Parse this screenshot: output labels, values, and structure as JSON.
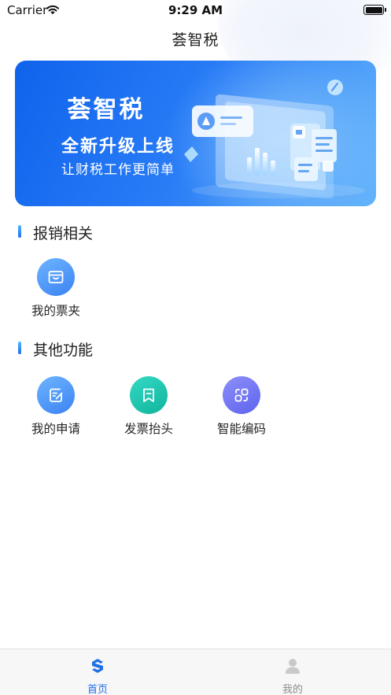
{
  "status_bar": {
    "carrier": "Carrier",
    "time": "9:29 AM"
  },
  "nav": {
    "title": "荟智税"
  },
  "banner": {
    "title": "荟智税",
    "subtitle": "全新升级上线",
    "tagline": "让财税工作更简单"
  },
  "sections": [
    {
      "title": "报销相关",
      "items": [
        {
          "label": "我的票夹",
          "icon": "wallet-icon",
          "color": "#4a90f5"
        }
      ]
    },
    {
      "title": "其他功能",
      "items": [
        {
          "label": "我的申请",
          "icon": "edit-document-icon",
          "color": "#4a90f5"
        },
        {
          "label": "发票抬头",
          "icon": "bookmark-icon",
          "color": "#1fc4ae"
        },
        {
          "label": "智能编码",
          "icon": "code-link-icon",
          "color": "#7074f2"
        }
      ]
    }
  ],
  "tabbar": {
    "tabs": [
      {
        "label": "首页",
        "icon": "home-logo-icon",
        "active": true,
        "color": "#1f6fe8"
      },
      {
        "label": "我的",
        "icon": "person-icon",
        "active": false,
        "color": "#8d8d8d"
      }
    ]
  }
}
